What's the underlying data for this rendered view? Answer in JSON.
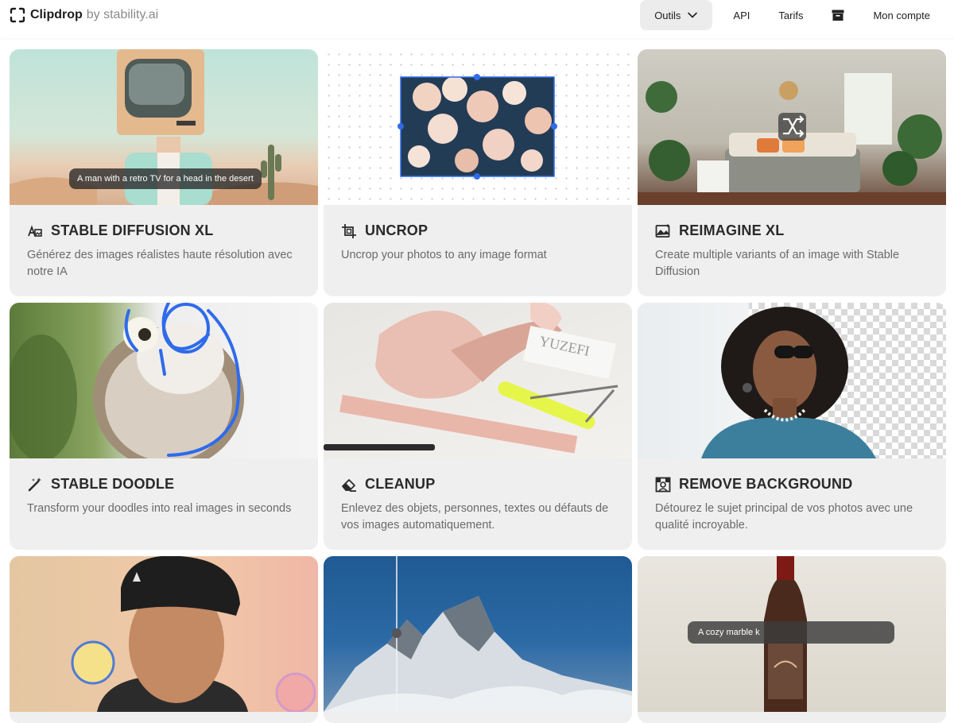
{
  "header": {
    "brand": "Clipdrop",
    "brand_suffix": "by stability.ai",
    "nav": {
      "tools": "Outils",
      "api": "API",
      "pricing": "Tarifs",
      "account": "Mon compte"
    }
  },
  "cards": [
    {
      "title": "STABLE DIFFUSION XL",
      "description": "Générez des images réalistes haute résolution avec notre IA",
      "image_caption": "A man with a retro TV for a head in the desert",
      "icon": "text-to-image-icon"
    },
    {
      "title": "UNCROP",
      "description": "Uncrop your photos to any image format",
      "icon": "crop-icon"
    },
    {
      "title": "REIMAGINE XL",
      "description": "Create multiple variants of an image with Stable Diffusion",
      "icon": "image-variant-icon"
    },
    {
      "title": "STABLE DOODLE",
      "description": "Transform your doodles into real images in seconds",
      "icon": "magic-wand-icon"
    },
    {
      "title": "CLEANUP",
      "description": "Enlevez des objets, personnes, textes ou défauts de vos images automatiquement.",
      "icon": "eraser-icon"
    },
    {
      "title": "REMOVE BACKGROUND",
      "description": "Détourez le sujet principal de vos photos avec une qualité incroyable.",
      "icon": "remove-background-icon"
    },
    {
      "title": "",
      "description": "",
      "icon": ""
    },
    {
      "title": "",
      "description": "",
      "icon": ""
    },
    {
      "title": "",
      "description": "",
      "image_caption": "A cozy marble k",
      "icon": ""
    }
  ],
  "colors": {
    "card_bg": "#efefef",
    "accent_blue": "#2f6bea",
    "nav_active_bg": "#ececec"
  }
}
